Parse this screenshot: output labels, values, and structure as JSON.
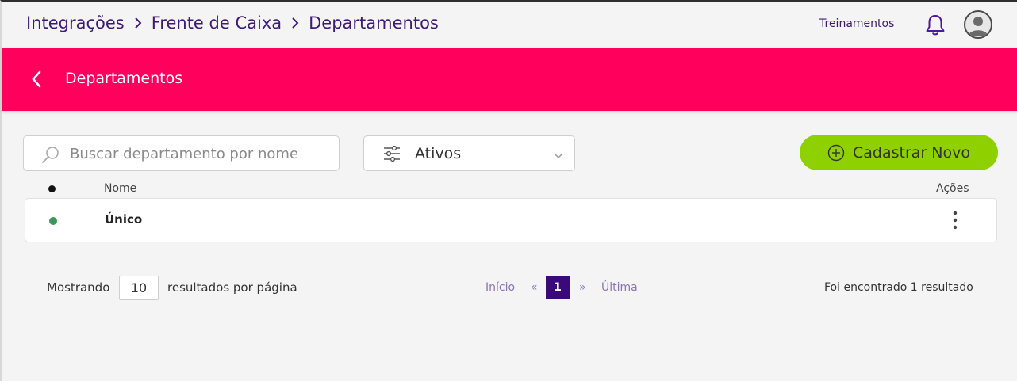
{
  "header": {
    "breadcrumb": [
      "Integrações",
      "Frente de Caixa",
      "Departamentos"
    ],
    "trainings_label": "Treinamentos"
  },
  "banner": {
    "title": "Departamentos",
    "color": "#ff005d"
  },
  "toolbar": {
    "search_placeholder": "Buscar departamento por nome",
    "filter_value": "Ativos",
    "new_button_label": "Cadastrar Novo",
    "new_button_color": "#8fd000"
  },
  "table": {
    "columns": {
      "name": "Nome",
      "actions": "Ações"
    },
    "rows": [
      {
        "name": "Único",
        "status_color": "#3a9a5a"
      }
    ]
  },
  "footer": {
    "showing_label": "Mostrando",
    "per_page_value": "10",
    "per_page_suffix": "resultados por página",
    "pagination": {
      "first": "Início",
      "prev": "«",
      "current": "1",
      "next": "»",
      "last": "Última"
    },
    "found_text": "Foi encontrado 1 resultado"
  },
  "colors": {
    "primary_purple": "#3d1a78",
    "active_page": "#3a0a78"
  }
}
